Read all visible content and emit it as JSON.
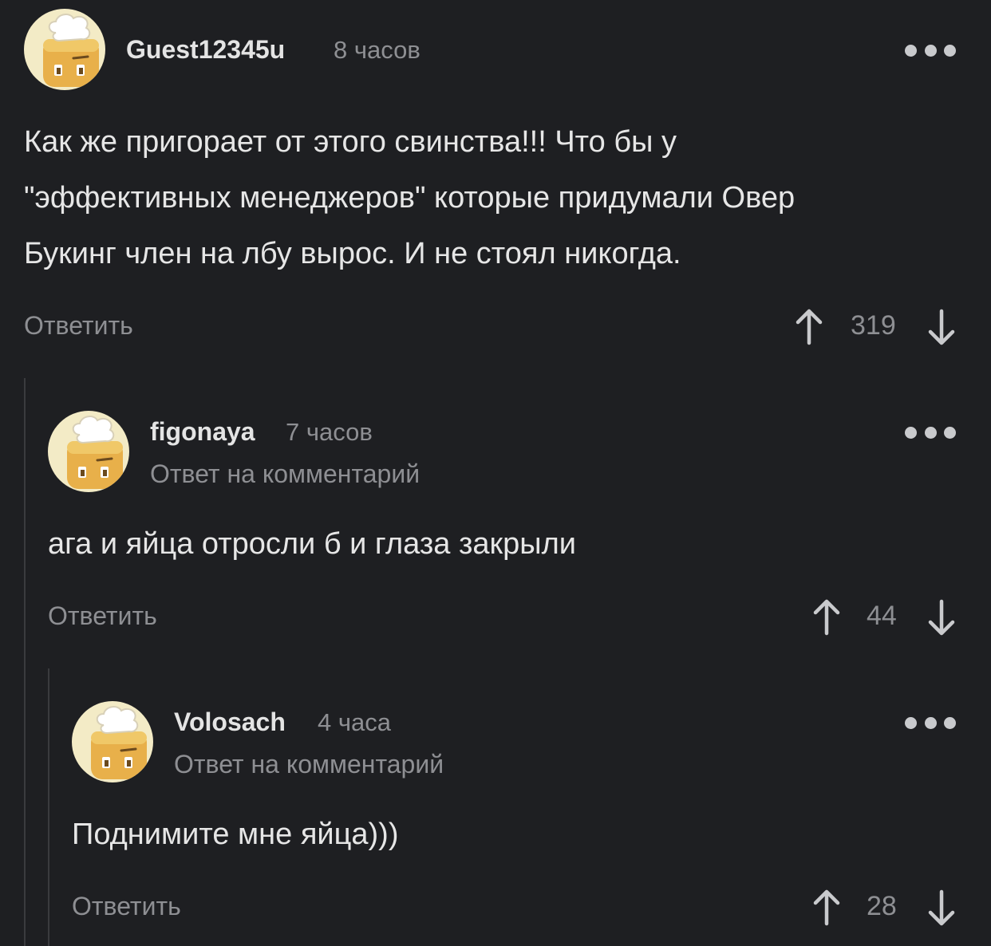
{
  "comments": [
    {
      "username": "Guest12345u",
      "time": "8 часов",
      "reply_to": "",
      "text_lines": [
        "Как же пригорает от этого свинства!!! Что бы у",
        "\"эффективных менеджеров\" которые придумали Овер",
        "Букинг член на лбу вырос. И не стоял никогда."
      ],
      "reply_label": "Ответить",
      "score": "319"
    },
    {
      "username": "figonaya",
      "time": "7 часов",
      "reply_to": "Ответ на комментарий",
      "text_lines": [
        "ага и яйца отросли б и глаза закрыли"
      ],
      "reply_label": "Ответить",
      "score": "44"
    },
    {
      "username": "Volosach",
      "time": "4 часа",
      "reply_to": "Ответ на комментарий",
      "text_lines": [
        "Поднимите мне яйца)))"
      ],
      "reply_label": "Ответить",
      "score": "28"
    }
  ],
  "icons": {
    "avatar": "chef-toast-avatar-icon",
    "more": "more-dots-icon",
    "upvote": "arrow-up-icon",
    "downvote": "arrow-down-icon"
  },
  "colors": {
    "background": "#1e1f22",
    "text": "#e6e6e6",
    "muted": "#8e8f93",
    "avatar_bg": "#f3ebc6"
  }
}
